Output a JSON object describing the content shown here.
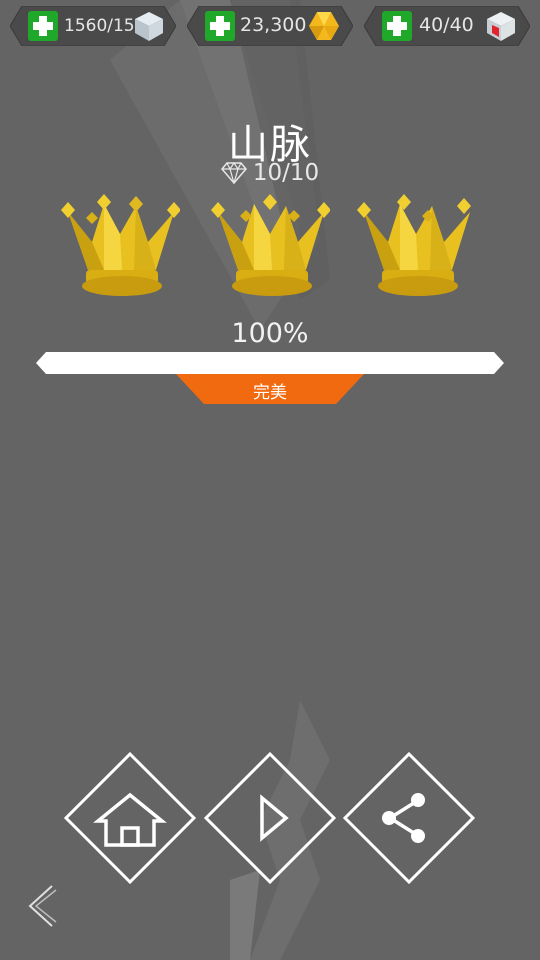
{
  "resources": [
    {
      "name": "pieces",
      "value": "1560/15",
      "icon": "cube-icon-grey",
      "add_icon": "plus-icon"
    },
    {
      "name": "gems",
      "value": "23,300",
      "icon": "gem-icon-gold",
      "add_icon": "plus-icon"
    },
    {
      "name": "energy",
      "value": "40/40",
      "icon": "energy-cube-icon",
      "add_icon": "plus-icon"
    }
  ],
  "level": {
    "title": "山脉",
    "diamonds": "10/10",
    "crowns_earned": 3,
    "crowns_total": 3
  },
  "progress": {
    "percent_label": "100%",
    "percent": 100,
    "rating_label": "完美"
  },
  "buttons": {
    "home_icon": "home-icon",
    "play_icon": "play-icon",
    "share_icon": "share-icon",
    "back_icon": "back-chevron-icon"
  },
  "colors": {
    "background": "#646464",
    "crown_gold": "#e8c020",
    "badge_orange": "#f26a0f",
    "plus_green": "#1fa82a"
  }
}
